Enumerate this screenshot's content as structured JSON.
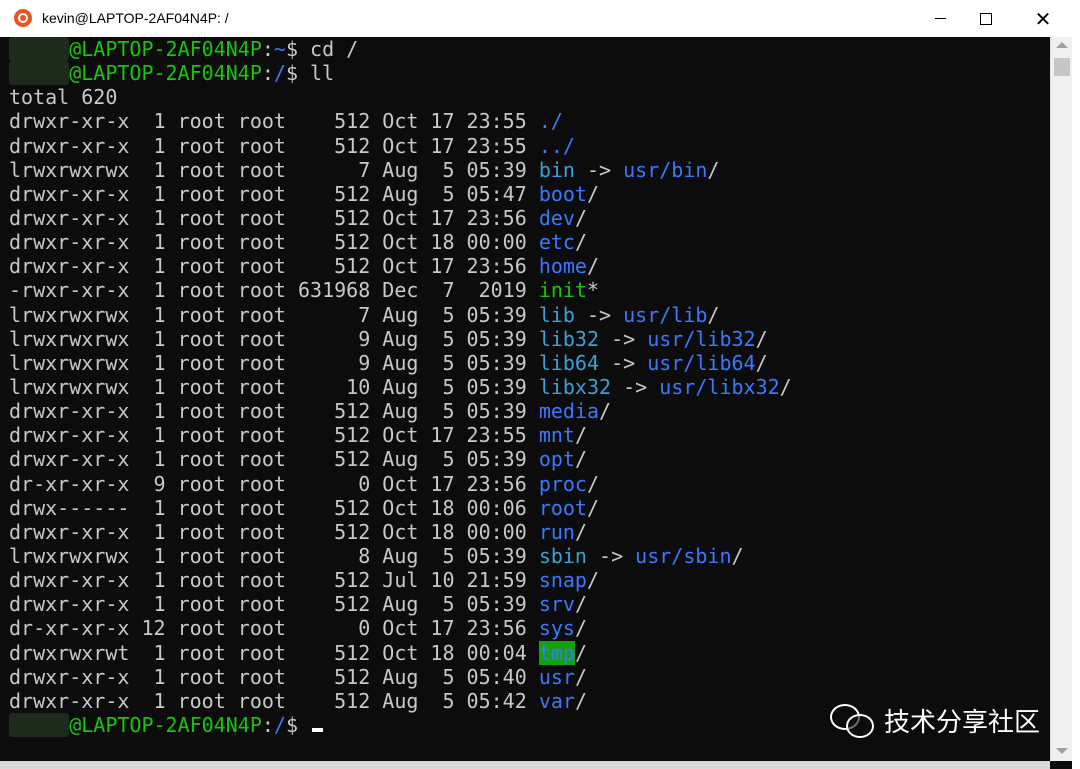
{
  "window": {
    "title": "kevin@LAPTOP-2AF04N4P: /",
    "controls": {
      "minimize": "—",
      "maximize": "☐",
      "close": "✕"
    }
  },
  "terminal": {
    "lines": [
      {
        "segments": [
          {
            "text": "kevin",
            "style": "blurred"
          },
          {
            "text": "@LAPTOP-2AF04N4P",
            "style": "user"
          },
          {
            "text": ":",
            "style": "plain"
          },
          {
            "text": "~",
            "style": "path"
          },
          {
            "text": "$ cd /",
            "style": "plain"
          }
        ]
      },
      {
        "segments": [
          {
            "text": "kevin",
            "style": "blurred"
          },
          {
            "text": "@LAPTOP-2AF04N4P",
            "style": "user"
          },
          {
            "text": ":",
            "style": "plain"
          },
          {
            "text": "/",
            "style": "path"
          },
          {
            "text": "$ ll",
            "style": "plain"
          }
        ]
      },
      {
        "segments": [
          {
            "text": "total 620",
            "style": "plain"
          }
        ]
      },
      {
        "segments": [
          {
            "text": "drwxr-xr-x  1 root root    512 Oct 17 23:55 ",
            "style": "plain"
          },
          {
            "text": "./",
            "style": "dir"
          }
        ]
      },
      {
        "segments": [
          {
            "text": "drwxr-xr-x  1 root root    512 Oct 17 23:55 ",
            "style": "plain"
          },
          {
            "text": "../",
            "style": "dir"
          }
        ]
      },
      {
        "segments": [
          {
            "text": "lrwxrwxrwx  1 root root      7 Aug  5 05:39 ",
            "style": "plain"
          },
          {
            "text": "bin",
            "style": "link"
          },
          {
            "text": " -> ",
            "style": "plain"
          },
          {
            "text": "usr/bin",
            "style": "dir"
          },
          {
            "text": "/",
            "style": "plain"
          }
        ]
      },
      {
        "segments": [
          {
            "text": "drwxr-xr-x  1 root root    512 Aug  5 05:47 ",
            "style": "plain"
          },
          {
            "text": "boot",
            "style": "dir"
          },
          {
            "text": "/",
            "style": "plain"
          }
        ]
      },
      {
        "segments": [
          {
            "text": "drwxr-xr-x  1 root root    512 Oct 17 23:56 ",
            "style": "plain"
          },
          {
            "text": "dev",
            "style": "dir"
          },
          {
            "text": "/",
            "style": "plain"
          }
        ]
      },
      {
        "segments": [
          {
            "text": "drwxr-xr-x  1 root root    512 Oct 18 00:00 ",
            "style": "plain"
          },
          {
            "text": "etc",
            "style": "dir"
          },
          {
            "text": "/",
            "style": "plain"
          }
        ]
      },
      {
        "segments": [
          {
            "text": "drwxr-xr-x  1 root root    512 Oct 17 23:56 ",
            "style": "plain"
          },
          {
            "text": "home",
            "style": "dir"
          },
          {
            "text": "/",
            "style": "plain"
          }
        ]
      },
      {
        "segments": [
          {
            "text": "-rwxr-xr-x  1 root root 631968 Dec  7  2019 ",
            "style": "plain"
          },
          {
            "text": "init",
            "style": "exec"
          },
          {
            "text": "*",
            "style": "plain"
          }
        ]
      },
      {
        "segments": [
          {
            "text": "lrwxrwxrwx  1 root root      7 Aug  5 05:39 ",
            "style": "plain"
          },
          {
            "text": "lib",
            "style": "link"
          },
          {
            "text": " -> ",
            "style": "plain"
          },
          {
            "text": "usr/lib",
            "style": "dir"
          },
          {
            "text": "/",
            "style": "plain"
          }
        ]
      },
      {
        "segments": [
          {
            "text": "lrwxrwxrwx  1 root root      9 Aug  5 05:39 ",
            "style": "plain"
          },
          {
            "text": "lib32",
            "style": "link"
          },
          {
            "text": " -> ",
            "style": "plain"
          },
          {
            "text": "usr/lib32",
            "style": "dir"
          },
          {
            "text": "/",
            "style": "plain"
          }
        ]
      },
      {
        "segments": [
          {
            "text": "lrwxrwxrwx  1 root root      9 Aug  5 05:39 ",
            "style": "plain"
          },
          {
            "text": "lib64",
            "style": "link"
          },
          {
            "text": " -> ",
            "style": "plain"
          },
          {
            "text": "usr/lib64",
            "style": "dir"
          },
          {
            "text": "/",
            "style": "plain"
          }
        ]
      },
      {
        "segments": [
          {
            "text": "lrwxrwxrwx  1 root root     10 Aug  5 05:39 ",
            "style": "plain"
          },
          {
            "text": "libx32",
            "style": "link"
          },
          {
            "text": " -> ",
            "style": "plain"
          },
          {
            "text": "usr/libx32",
            "style": "dir"
          },
          {
            "text": "/",
            "style": "plain"
          }
        ]
      },
      {
        "segments": [
          {
            "text": "drwxr-xr-x  1 root root    512 Aug  5 05:39 ",
            "style": "plain"
          },
          {
            "text": "media",
            "style": "dir"
          },
          {
            "text": "/",
            "style": "plain"
          }
        ]
      },
      {
        "segments": [
          {
            "text": "drwxr-xr-x  1 root root    512 Oct 17 23:55 ",
            "style": "plain"
          },
          {
            "text": "mnt",
            "style": "dir"
          },
          {
            "text": "/",
            "style": "plain"
          }
        ]
      },
      {
        "segments": [
          {
            "text": "drwxr-xr-x  1 root root    512 Aug  5 05:39 ",
            "style": "plain"
          },
          {
            "text": "opt",
            "style": "dir"
          },
          {
            "text": "/",
            "style": "plain"
          }
        ]
      },
      {
        "segments": [
          {
            "text": "dr-xr-xr-x  9 root root      0 Oct 17 23:56 ",
            "style": "plain"
          },
          {
            "text": "proc",
            "style": "dir"
          },
          {
            "text": "/",
            "style": "plain"
          }
        ]
      },
      {
        "segments": [
          {
            "text": "drwx------  1 root root    512 Oct 18 00:06 ",
            "style": "plain"
          },
          {
            "text": "root",
            "style": "dir"
          },
          {
            "text": "/",
            "style": "plain"
          }
        ]
      },
      {
        "segments": [
          {
            "text": "drwxr-xr-x  1 root root    512 Oct 18 00:00 ",
            "style": "plain"
          },
          {
            "text": "run",
            "style": "dir"
          },
          {
            "text": "/",
            "style": "plain"
          }
        ]
      },
      {
        "segments": [
          {
            "text": "lrwxrwxrwx  1 root root      8 Aug  5 05:39 ",
            "style": "plain"
          },
          {
            "text": "sbin",
            "style": "link"
          },
          {
            "text": " -> ",
            "style": "plain"
          },
          {
            "text": "usr/sbin",
            "style": "dir"
          },
          {
            "text": "/",
            "style": "plain"
          }
        ]
      },
      {
        "segments": [
          {
            "text": "drwxr-xr-x  1 root root    512 Jul 10 21:59 ",
            "style": "plain"
          },
          {
            "text": "snap",
            "style": "dir"
          },
          {
            "text": "/",
            "style": "plain"
          }
        ]
      },
      {
        "segments": [
          {
            "text": "drwxr-xr-x  1 root root    512 Aug  5 05:39 ",
            "style": "plain"
          },
          {
            "text": "srv",
            "style": "dir"
          },
          {
            "text": "/",
            "style": "plain"
          }
        ]
      },
      {
        "segments": [
          {
            "text": "dr-xr-xr-x 12 root root      0 Oct 17 23:56 ",
            "style": "plain"
          },
          {
            "text": "sys",
            "style": "dir"
          },
          {
            "text": "/",
            "style": "plain"
          }
        ]
      },
      {
        "segments": [
          {
            "text": "drwxrwxrwt  1 root root    512 Oct 18 00:04 ",
            "style": "plain"
          },
          {
            "text": "tmp",
            "style": "sticky"
          },
          {
            "text": "/",
            "style": "plain"
          }
        ]
      },
      {
        "segments": [
          {
            "text": "drwxr-xr-x  1 root root    512 Aug  5 05:40 ",
            "style": "plain"
          },
          {
            "text": "usr",
            "style": "dir"
          },
          {
            "text": "/",
            "style": "plain"
          }
        ]
      },
      {
        "segments": [
          {
            "text": "drwxr-xr-x  1 root root    512 Aug  5 05:42 ",
            "style": "plain"
          },
          {
            "text": "var",
            "style": "dir"
          },
          {
            "text": "/",
            "style": "plain"
          }
        ]
      },
      {
        "segments": [
          {
            "text": "kevin",
            "style": "blurred"
          },
          {
            "text": "@LAPTOP-2AF04N4P",
            "style": "user"
          },
          {
            "text": ":",
            "style": "plain"
          },
          {
            "text": "/",
            "style": "path"
          },
          {
            "text": "$ ",
            "style": "plain"
          }
        ],
        "cursor": true
      }
    ]
  },
  "watermark": {
    "text": "技术分享社区",
    "icon": "wechat-icon"
  },
  "colors": {
    "background": "#0c0c0c",
    "foreground": "#c8c8c8",
    "user": "#16c60c",
    "directory": "#3b78ff",
    "symlink": "#3aa2d8",
    "sticky_bg": "#13a10e"
  }
}
